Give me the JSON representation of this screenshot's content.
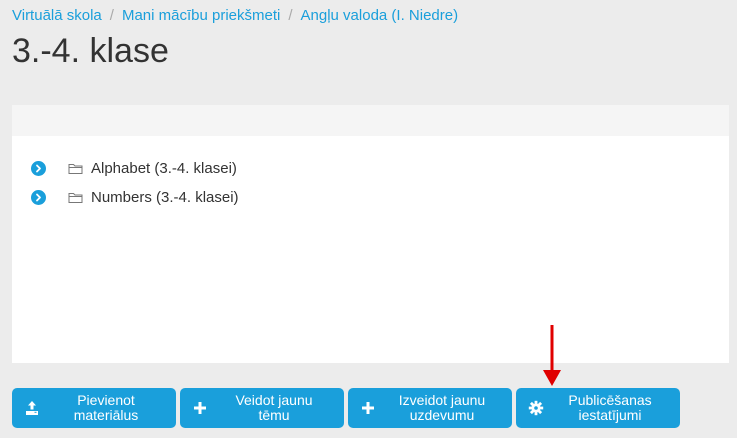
{
  "breadcrumb": {
    "items": [
      "Virtuālā skola",
      "Mani mācību priekšmeti",
      "Angļu valoda (I. Niedre)"
    ],
    "separator": "/"
  },
  "page": {
    "title": "3.-4. klase"
  },
  "tree": {
    "items": [
      {
        "label": "Alphabet (3.-4. klasei)",
        "icon": "folder-icon"
      },
      {
        "label": "Numbers (3.-4. klasei)",
        "icon": "folder-icon"
      }
    ]
  },
  "actions": {
    "add_material": {
      "line1": "Pievienot",
      "line2": "materiālus",
      "icon": "upload-icon"
    },
    "new_topic": {
      "line1": "Veidot jaunu",
      "line2": "tēmu",
      "icon": "plus-icon"
    },
    "new_task": {
      "line1": "Izveidot jaunu",
      "line2": "uzdevumu",
      "icon": "plus-icon"
    },
    "publish_settings": {
      "line1": "Publicēšanas",
      "line2": "iestatījumi",
      "icon": "gear-icon"
    }
  },
  "colors": {
    "accent": "#1a9fdb",
    "background": "#ececec",
    "panel": "#ffffff",
    "annotation_arrow": "#e00000"
  }
}
